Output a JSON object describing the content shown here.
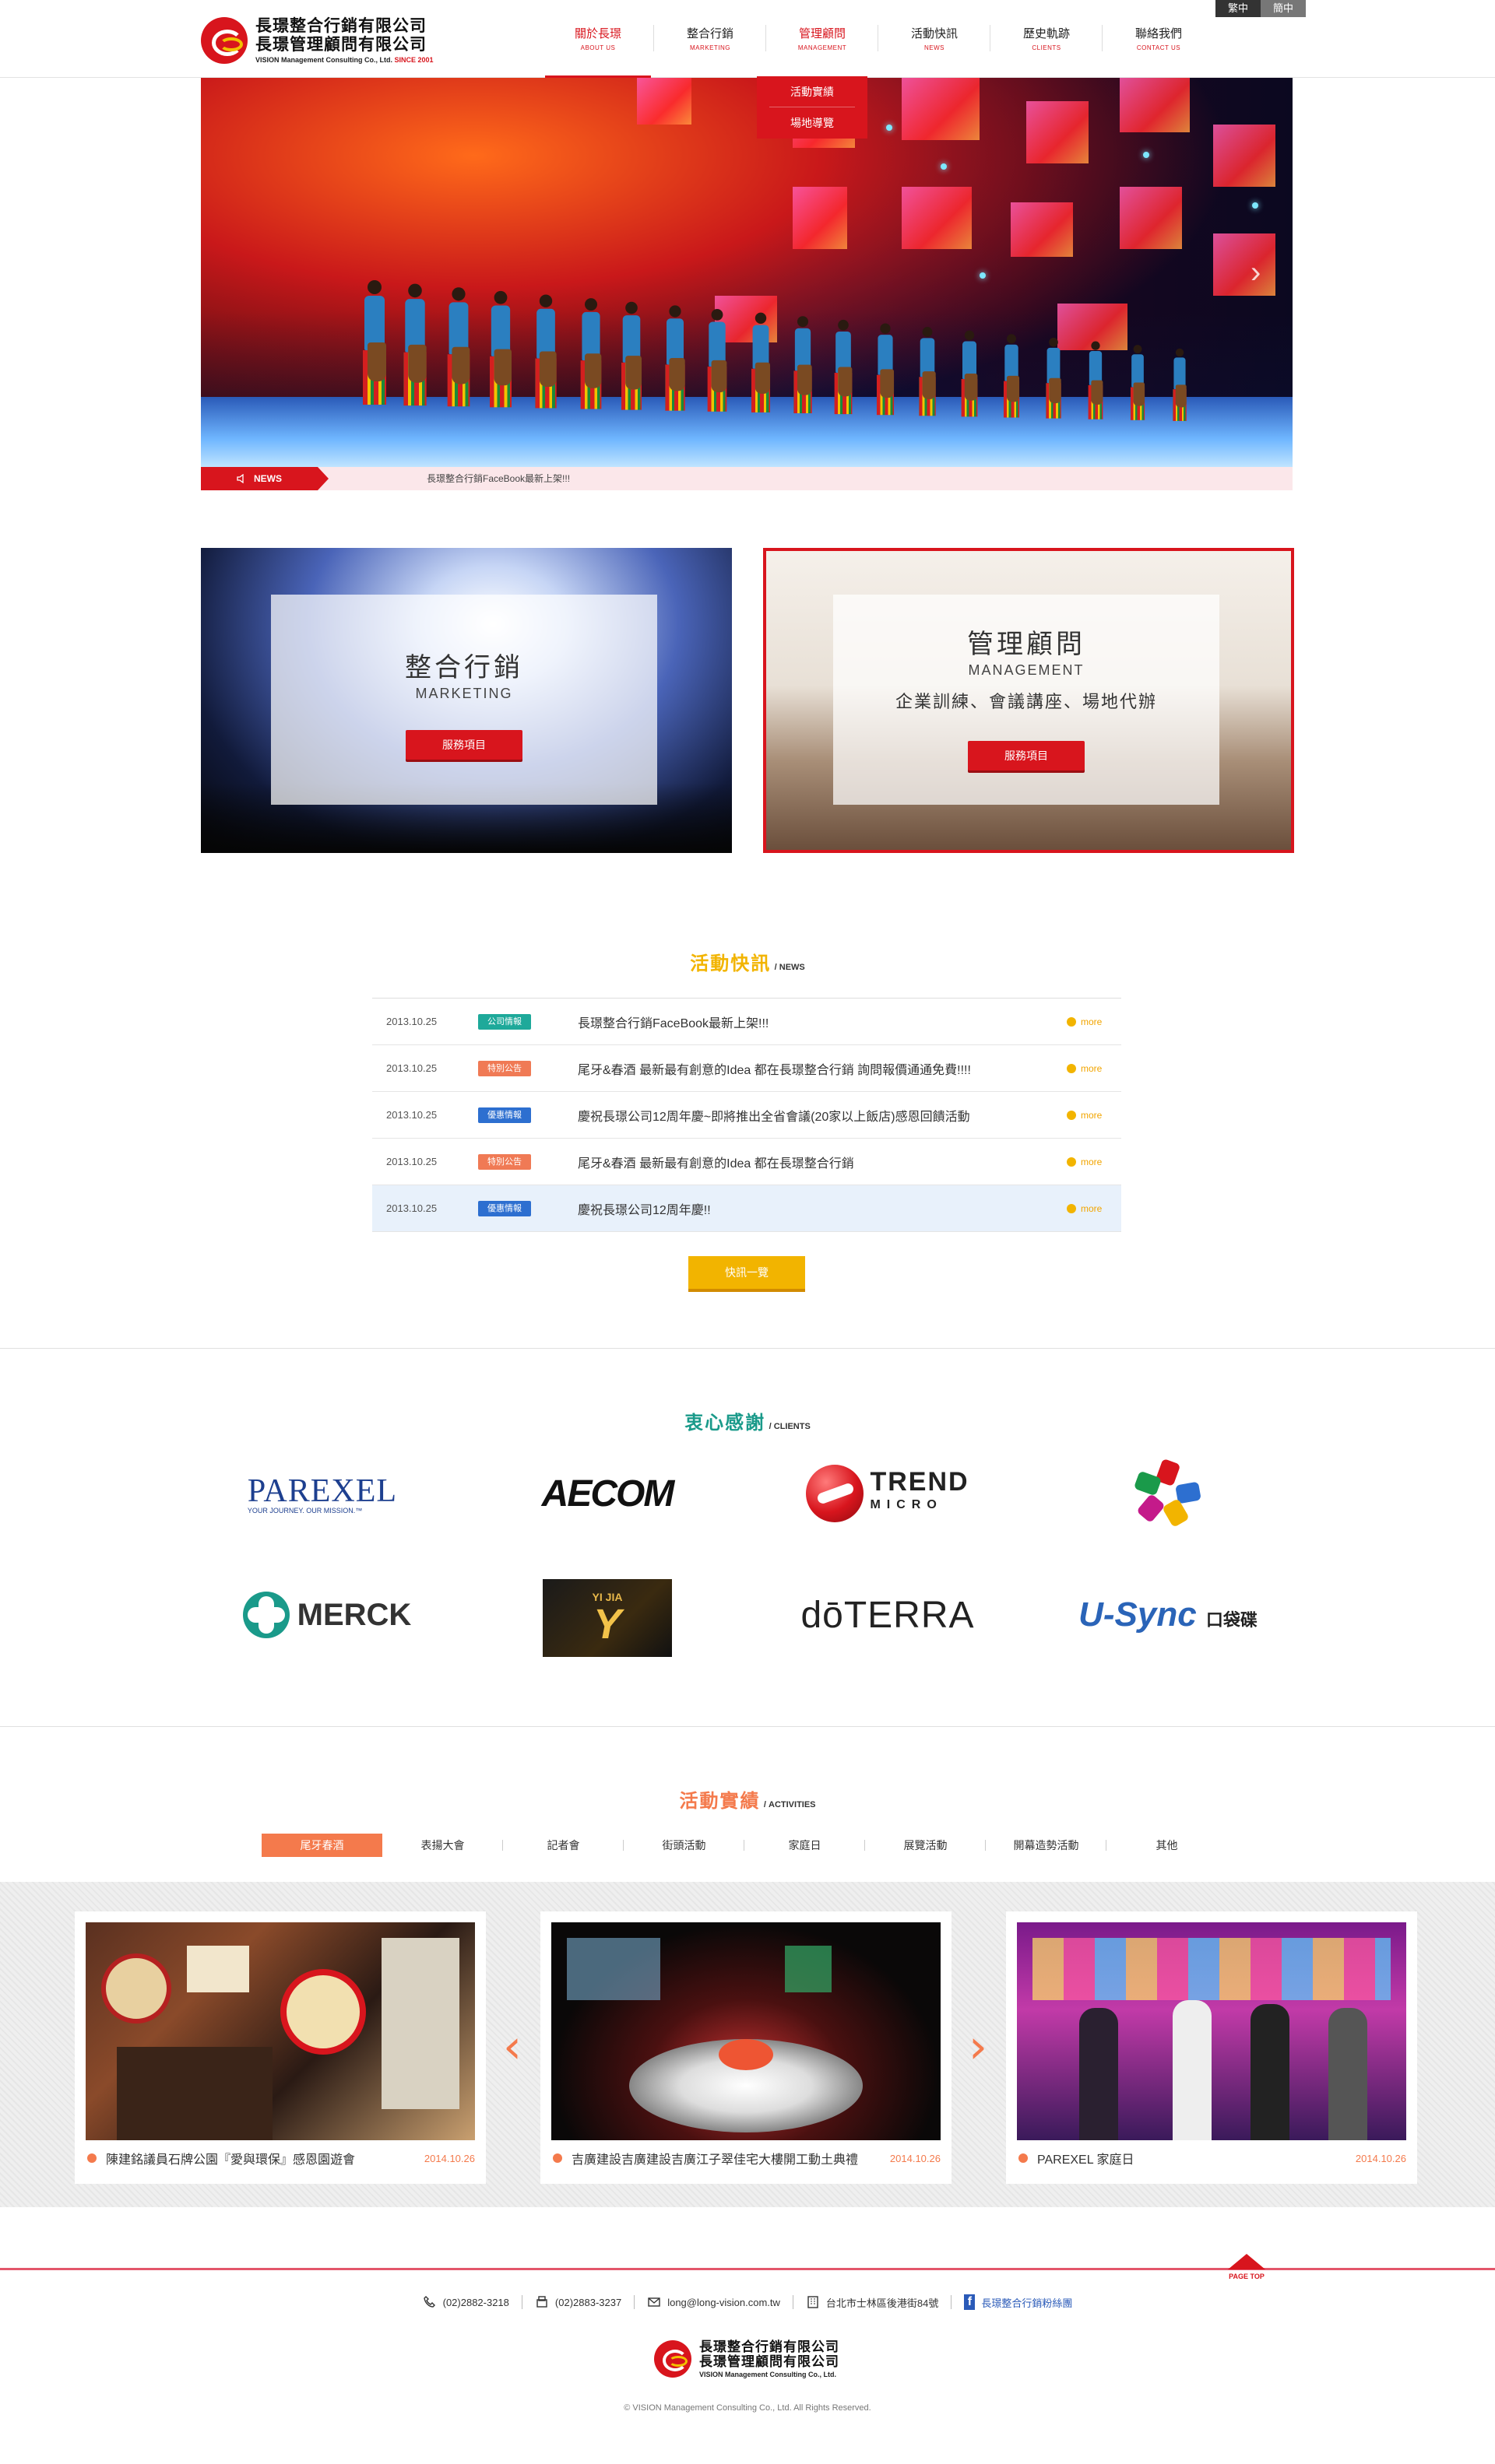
{
  "lang": {
    "trad": "繁中",
    "simp": "簡中"
  },
  "brand": {
    "name1": "長璟整合行銷有限公司",
    "name2": "長璟管理顧問有限公司",
    "en": "VISION Management Consulting Co., Ltd.",
    "since": "SINCE 2001"
  },
  "nav": [
    {
      "zh": "關於長璟",
      "en": "ABOUT US"
    },
    {
      "zh": "整合行銷",
      "en": "MARKETING"
    },
    {
      "zh": "管理顧問",
      "en": "MANAGEMENT"
    },
    {
      "zh": "活動快訊",
      "en": "NEWS"
    },
    {
      "zh": "歷史軌跡",
      "en": "CLIENTS"
    },
    {
      "zh": "聯絡我們",
      "en": "CONTACT US"
    }
  ],
  "dropdown": [
    "活動實績",
    "場地導覽"
  ],
  "newsbar": {
    "tag": "NEWS",
    "text": "長璟整合行銷FaceBook最新上架!!!"
  },
  "cards": {
    "marketing": {
      "zh": "整合行銷",
      "en": "MARKETING",
      "button": "服務項目"
    },
    "management": {
      "zh": "管理顧問",
      "en": "MANAGEMENT",
      "desc": "企業訓練、會議講座、場地代辦",
      "button": "服務項目"
    }
  },
  "news": {
    "title_zh": "活動快訊",
    "title_en": "/ NEWS",
    "more_label": "more",
    "button": "快訊一覽",
    "items": [
      {
        "date": "2013.10.25",
        "badge": "公司情報",
        "badge_color": "#1ea99a",
        "title": "長璟整合行銷FaceBook最新上架!!!"
      },
      {
        "date": "2013.10.25",
        "badge": "特別公告",
        "badge_color": "#f07a55",
        "title": "尾牙&春酒 最新最有創意的Idea 都在長璟整合行銷 詢問報價通通免費!!!!"
      },
      {
        "date": "2013.10.25",
        "badge": "優惠情報",
        "badge_color": "#2d6fd0",
        "title": "慶祝長璟公司12周年慶~即將推出全省會議(20家以上飯店)感恩回饋活動"
      },
      {
        "date": "2013.10.25",
        "badge": "特別公告",
        "badge_color": "#f07a55",
        "title": "尾牙&春酒 最新最有創意的Idea 都在長璟整合行銷"
      },
      {
        "date": "2013.10.25",
        "badge": "優惠情報",
        "badge_color": "#2d6fd0",
        "title": "慶祝長璟公司12周年慶!!"
      }
    ]
  },
  "clients": {
    "title_zh": "衷心感謝",
    "title_en": "/ CLIENTS",
    "parexel": "PAREXEL",
    "parexel_tag": "YOUR JOURNEY. OUR MISSION.™",
    "aecom": "AECOM",
    "trend": "TREND",
    "trend_sub": "MICRO",
    "merck": "MERCK",
    "yijia": "YI JIA",
    "doterra": "dōTERRA",
    "usync": "U-Sync",
    "usync_sub": "口袋碟"
  },
  "activities": {
    "title_zh": "活動實績",
    "title_en": "/ ACTIVITIES",
    "tabs": [
      "尾牙春酒",
      "表揚大會",
      "記者會",
      "街頭活動",
      "家庭日",
      "展覽活動",
      "開幕造勢活動",
      "其他"
    ],
    "items": [
      {
        "title": "陳建銘議員石牌公園『愛與環保』感恩園遊會",
        "date": "2014.10.26"
      },
      {
        "title": "吉廣建設吉廣建設吉廣江子翠佳宅大樓開工動土典禮",
        "date": "2014.10.26"
      },
      {
        "title": "PAREXEL 家庭日",
        "date": "2014.10.26"
      }
    ]
  },
  "footer": {
    "pagetop": "PAGE TOP",
    "tel": "(02)2882-3218",
    "fax": "(02)2883-3237",
    "email": "long@long-vision.com.tw",
    "address": "台北市士林區後港街84號",
    "facebook": "長璟整合行銷粉絲團",
    "copyright": "© VISION Management Consulting Co., Ltd. All Rights Reserved."
  },
  "colors": {
    "brand_red": "#d8151d",
    "news_orange": "#f2b400",
    "clients_teal": "#1a9a8a",
    "activity_orange": "#f47a4c"
  }
}
